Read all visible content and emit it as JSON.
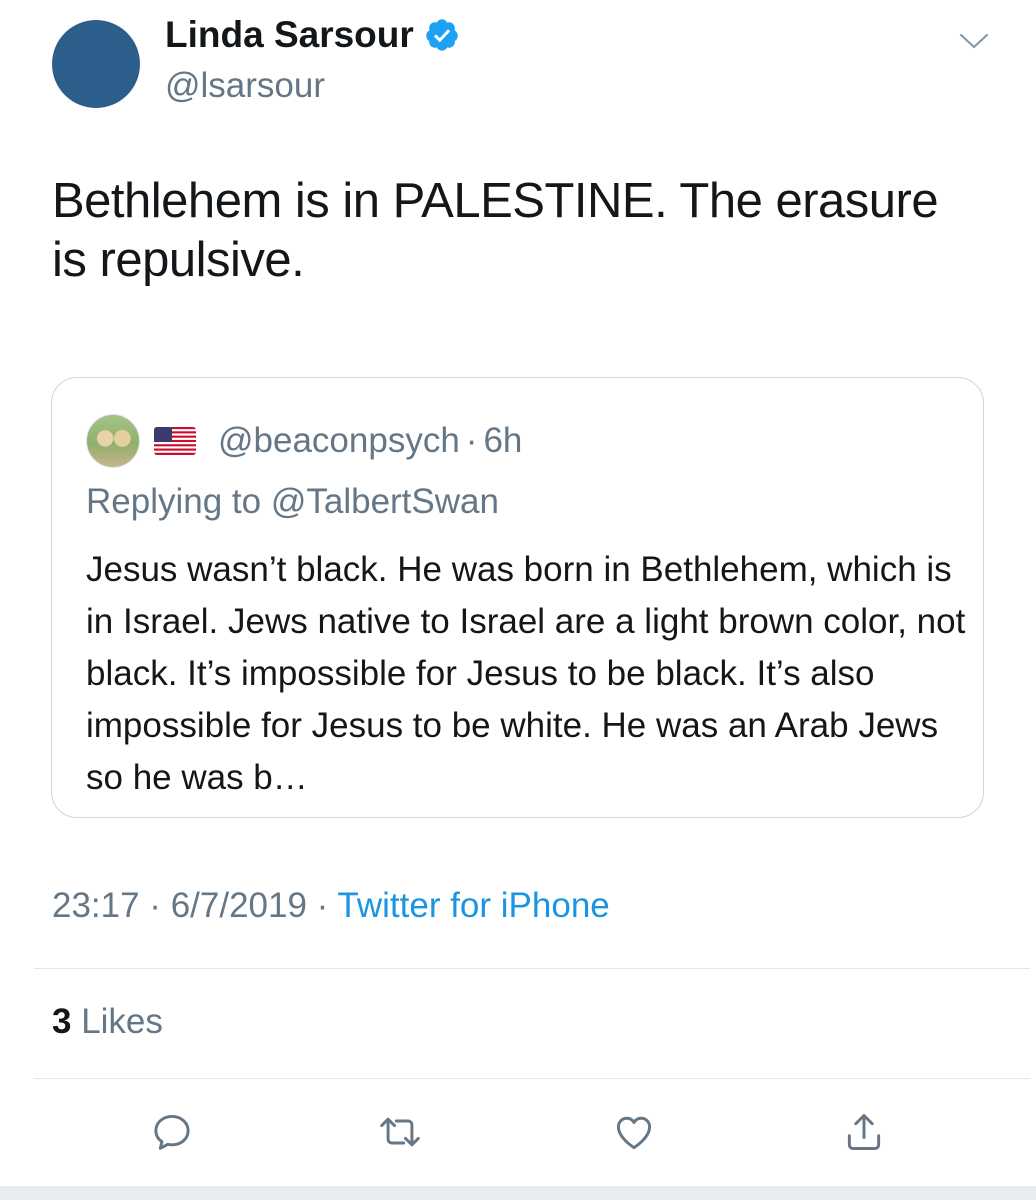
{
  "tweet": {
    "author_name": "Linda Sarsour",
    "author_handle": "@lsarsour",
    "text": "Bethlehem is in PALESTINE. The erasure is repulsive.",
    "timestamp": "23:17 · 6/7/2019 · ",
    "source": "Twitter for iPhone",
    "likes_count": "3",
    "likes_label": " Likes",
    "icons": {
      "verified": "verified-badge-icon",
      "menu": "chevron-down-icon",
      "reply": "reply-icon",
      "retweet": "retweet-icon",
      "like": "heart-icon",
      "share": "share-icon"
    }
  },
  "quoted_tweet": {
    "handle": "@beaconpsych",
    "separator": "·",
    "time": "6h",
    "replying_to": "Replying to @TalbertSwan",
    "text": "Jesus wasn’t black. He was born in Bethlehem, which is in Israel. Jews native to Israel are a light brown color, not black. It’s impossible for Jesus to be black. It’s also impossible for Jesus to be white. He was an Arab Jews so he was b…",
    "flag": "us-flag-icon"
  },
  "colors": {
    "accent": "#1b95e0",
    "muted": "#657786",
    "text": "#14171a",
    "border": "#ccd6dd",
    "avatar": "#2d5d8a"
  }
}
